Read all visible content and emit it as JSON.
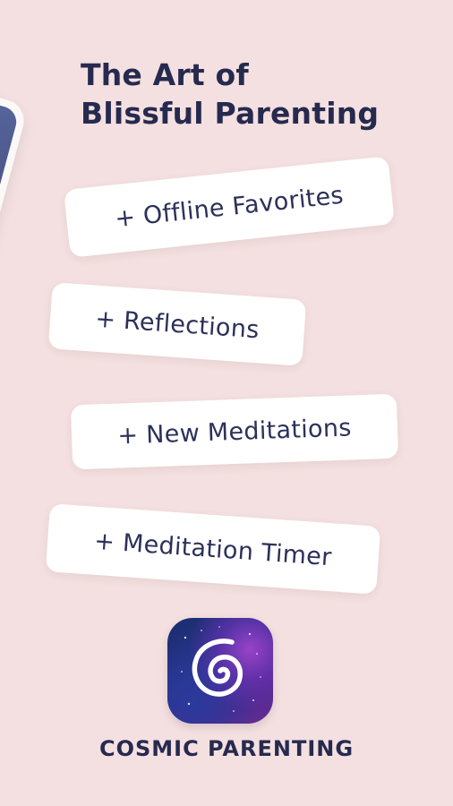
{
  "headline": {
    "line1": "The Art of",
    "line2": "Blissful Parenting"
  },
  "features": [
    "+ Offline Favorites",
    "+ Reflections",
    "+ New Meditations",
    "+ Meditation Timer"
  ],
  "brand": {
    "name": "COSMIC PARENTING",
    "icon": "spiral-galaxy-icon"
  },
  "colors": {
    "background": "#f4e0e0",
    "text": "#262a4f",
    "pill": "#ffffff",
    "icon_blue": "#28338a",
    "icon_purple": "#6a2c95"
  }
}
